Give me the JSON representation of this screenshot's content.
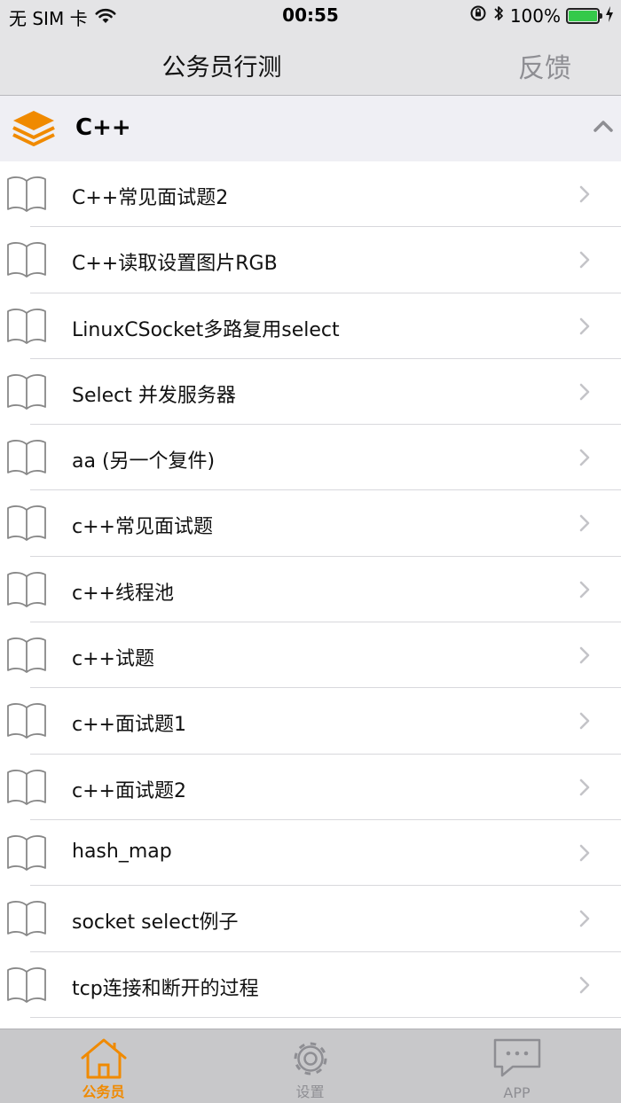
{
  "status_bar": {
    "carrier": "无 SIM 卡",
    "time": "00:55",
    "battery": "100%",
    "battery_level": 1.0
  },
  "nav": {
    "title": "公务员行测",
    "feedback_label": "反馈"
  },
  "section": {
    "title": "C++"
  },
  "items": [
    {
      "label": "C++常见面试题2"
    },
    {
      "label": "C++读取设置图片RGB"
    },
    {
      "label": "LinuxCSocket多路复用select"
    },
    {
      "label": "Select 并发服务器"
    },
    {
      "label": "aa (另一个复件)"
    },
    {
      "label": "c++常见面试题"
    },
    {
      "label": "c++线程池"
    },
    {
      "label": "c++试题"
    },
    {
      "label": "c++面试题1"
    },
    {
      "label": "c++面试题2"
    },
    {
      "label": "hash_map"
    },
    {
      "label": "socket select例子"
    },
    {
      "label": "tcp连接和断开的过程"
    },
    {
      "label": ""
    }
  ],
  "tabs": [
    {
      "label": "公务员",
      "active": true
    },
    {
      "label": "设置",
      "active": false
    },
    {
      "label": "APP",
      "active": false
    }
  ],
  "colors": {
    "accent": "#f08a00",
    "inactive": "#8e8e93",
    "battery": "#34c94a"
  }
}
